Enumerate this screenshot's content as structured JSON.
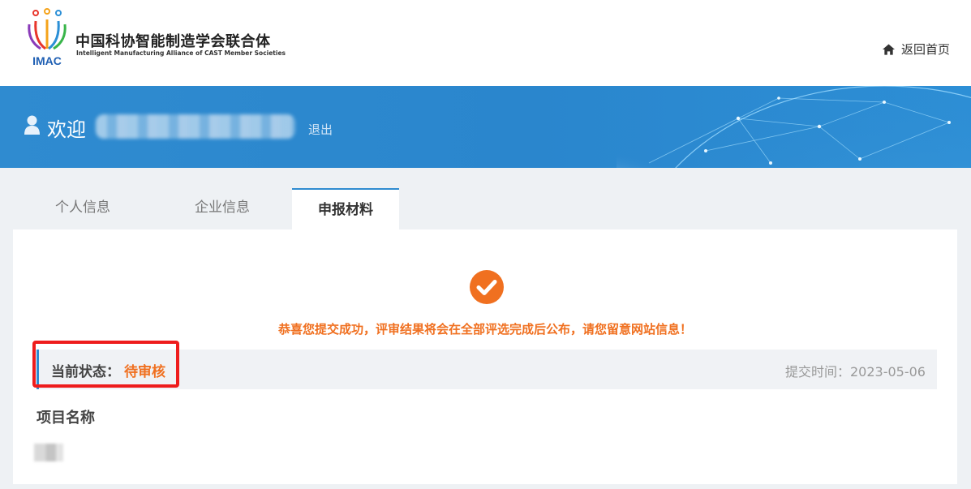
{
  "header": {
    "org_name_cn": "中国科协智能制造学会联合体",
    "org_name_en": "Intelligent Manufacturing Alliance of CAST Member Societies",
    "logo_text": "IMAC",
    "home_link": "返回首页",
    "home_icon": "home-icon"
  },
  "banner": {
    "welcome": "欢迎",
    "logout": "退出",
    "user_icon": "user-icon"
  },
  "tabs": [
    {
      "label": "个人信息",
      "active": false
    },
    {
      "label": "企业信息",
      "active": false
    },
    {
      "label": "申报材料",
      "active": true
    }
  ],
  "main": {
    "success_icon": "check-circle-icon",
    "success_message": "恭喜您提交成功，评审结果将会在全部评选完成后公布，请您留意网站信息！",
    "status_label": "当前状态：",
    "status_value": "待审核",
    "submit_time": "提交时间：2023-05-06",
    "project_title": "项目名称"
  },
  "colors": {
    "brand_blue": "#2f8bd0",
    "accent_orange": "#f07020",
    "highlight_red": "#ee1c1c"
  }
}
